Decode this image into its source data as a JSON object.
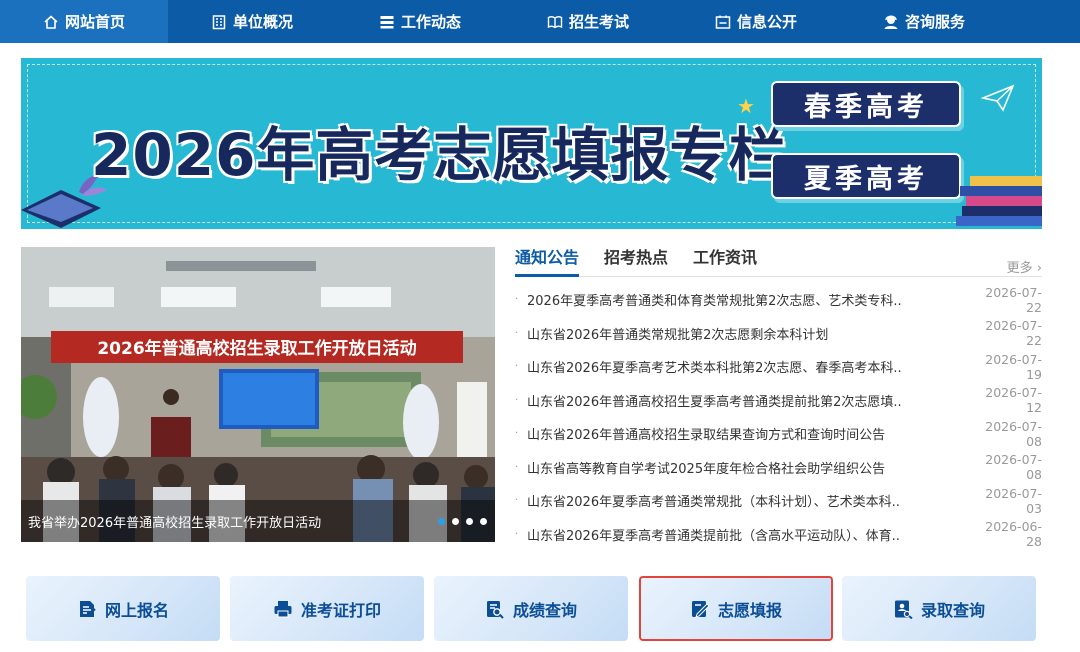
{
  "nav": {
    "items": [
      {
        "label": "网站首页",
        "icon": "home-icon"
      },
      {
        "label": "单位概况",
        "icon": "building-icon"
      },
      {
        "label": "工作动态",
        "icon": "list-icon"
      },
      {
        "label": "招生考试",
        "icon": "book-icon"
      },
      {
        "label": "信息公开",
        "icon": "info-box-icon"
      },
      {
        "label": "咨询服务",
        "icon": "user-service-icon"
      }
    ],
    "active_index": 0
  },
  "banner": {
    "title": "2026年高考志愿填报专栏",
    "spring_button": "春季高考",
    "summer_button": "夏季高考"
  },
  "carousel": {
    "caption": "我省举办2026年普通高校招生录取工作开放日活动",
    "photo_banner_text": "2026年普通高校招生录取工作开放日活动",
    "dots": 4,
    "active_dot": 0
  },
  "news": {
    "tabs": [
      "通知公告",
      "招考热点",
      "工作资讯"
    ],
    "more": "更多",
    "items": [
      {
        "title": "2026年夏季高考普通类和体育类常规批第2次志愿、艺术类专科..",
        "date": "2026-07-22"
      },
      {
        "title": "山东省2026年普通类常规批第2次志愿剩余本科计划",
        "date": "2026-07-22"
      },
      {
        "title": "山东省2026年夏季高考艺术类本科批第2次志愿、春季高考本科..",
        "date": "2026-07-19"
      },
      {
        "title": "山东省2026年普通高校招生夏季高考普通类提前批第2次志愿填..",
        "date": "2026-07-12"
      },
      {
        "title": "山东省2026年普通高校招生录取结果查询方式和查询时间公告",
        "date": "2026-07-08"
      },
      {
        "title": "山东省高等教育自学考试2025年度年检合格社会助学组织公告",
        "date": "2026-07-08"
      },
      {
        "title": "山东省2026年夏季高考普通类常规批（本科计划）、艺术类本科..",
        "date": "2026-07-03"
      },
      {
        "title": "山东省2026年夏季高考普通类提前批（含高水平运动队）、体育..",
        "date": "2026-06-28"
      }
    ]
  },
  "quick_links": [
    {
      "label": "网上报名",
      "icon": "register-icon"
    },
    {
      "label": "准考证打印",
      "icon": "printer-icon"
    },
    {
      "label": "成绩查询",
      "icon": "score-search-icon"
    },
    {
      "label": "志愿填报",
      "icon": "edit-form-icon",
      "highlighted": true
    },
    {
      "label": "录取查询",
      "icon": "admission-search-icon"
    }
  ],
  "colors": {
    "nav": "#0c5ba6",
    "banner": "#27b9d3",
    "highlight_border": "#e2433a"
  }
}
